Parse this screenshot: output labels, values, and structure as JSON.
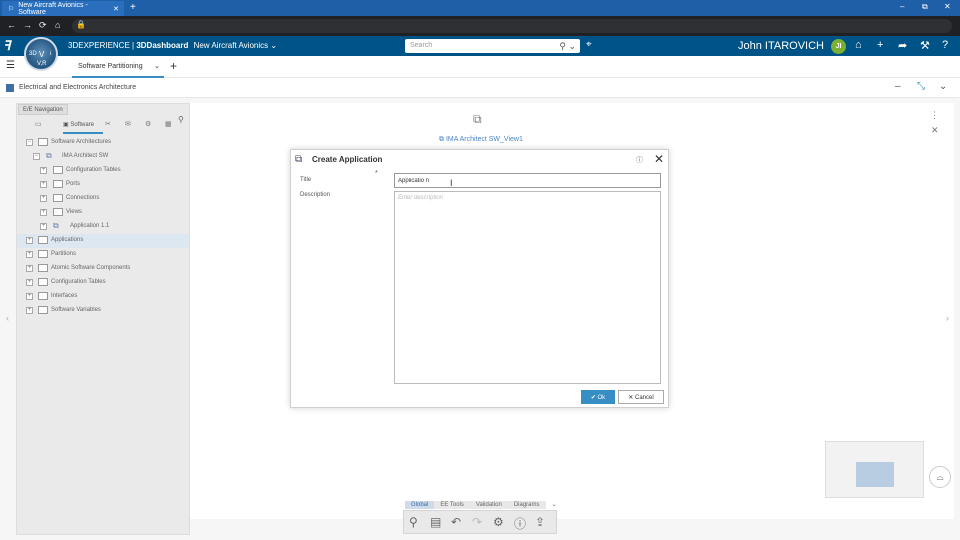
{
  "browser": {
    "tab_title": "New Aircraft Avionics - Software",
    "new_tab": "+",
    "window_controls": [
      "–",
      "⧉",
      "✕"
    ]
  },
  "header": {
    "brand_prefix": "3DEXPERIENCE | ",
    "brand_app": "3DDashboard",
    "dashboard_name": "New Aircraft Avionics",
    "search_placeholder": "Search",
    "user_name": "John ITAROVICH",
    "user_initials": "JI",
    "compass_labels": [
      "3D",
      "V",
      "i",
      "V,R"
    ]
  },
  "dashboard_tabs": {
    "active": "Software Partitioning",
    "add": "+"
  },
  "widget": {
    "title": "Electrical and Electronics Architecture"
  },
  "navigation": {
    "panel_tab": "E/E Navigation",
    "active_tab": "Software",
    "tree": [
      {
        "label": "Software Architectures",
        "toggle": "−"
      },
      {
        "label": "IMA Architect SW",
        "toggle": "−"
      },
      {
        "label": "Configuration Tables",
        "toggle": "+"
      },
      {
        "label": "Ports",
        "toggle": "+"
      },
      {
        "label": "Connections",
        "toggle": "+"
      },
      {
        "label": "Views",
        "toggle": "+"
      },
      {
        "label": "Application 1.1",
        "toggle": "+"
      },
      {
        "label": "Applications",
        "toggle": "+"
      },
      {
        "label": "Partitions",
        "toggle": "+"
      },
      {
        "label": "Atomic Software Components",
        "toggle": "+"
      },
      {
        "label": "Configuration Tables",
        "toggle": "+"
      },
      {
        "label": "Interfaces",
        "toggle": "+"
      },
      {
        "label": "Software Variables",
        "toggle": "+"
      }
    ]
  },
  "canvas": {
    "view_title": "IMA Architect SW_View1"
  },
  "bottom_toolbar": {
    "tabs": [
      "Global",
      "EE Tools",
      "Validation",
      "Diagrams"
    ],
    "active_tab": "Global"
  },
  "dialog": {
    "title": "Create Application",
    "title_label": "Title",
    "required_marker": "*",
    "title_value": "Applicatio n",
    "description_label": "Description",
    "description_placeholder": "Enter description",
    "ok_label": "Ok",
    "cancel_label": "Cancel"
  },
  "colors": {
    "topbar": "#005386",
    "accent": "#368ec4",
    "browser_tabstrip": "#1f5fa8",
    "avatar": "#7bb032"
  }
}
